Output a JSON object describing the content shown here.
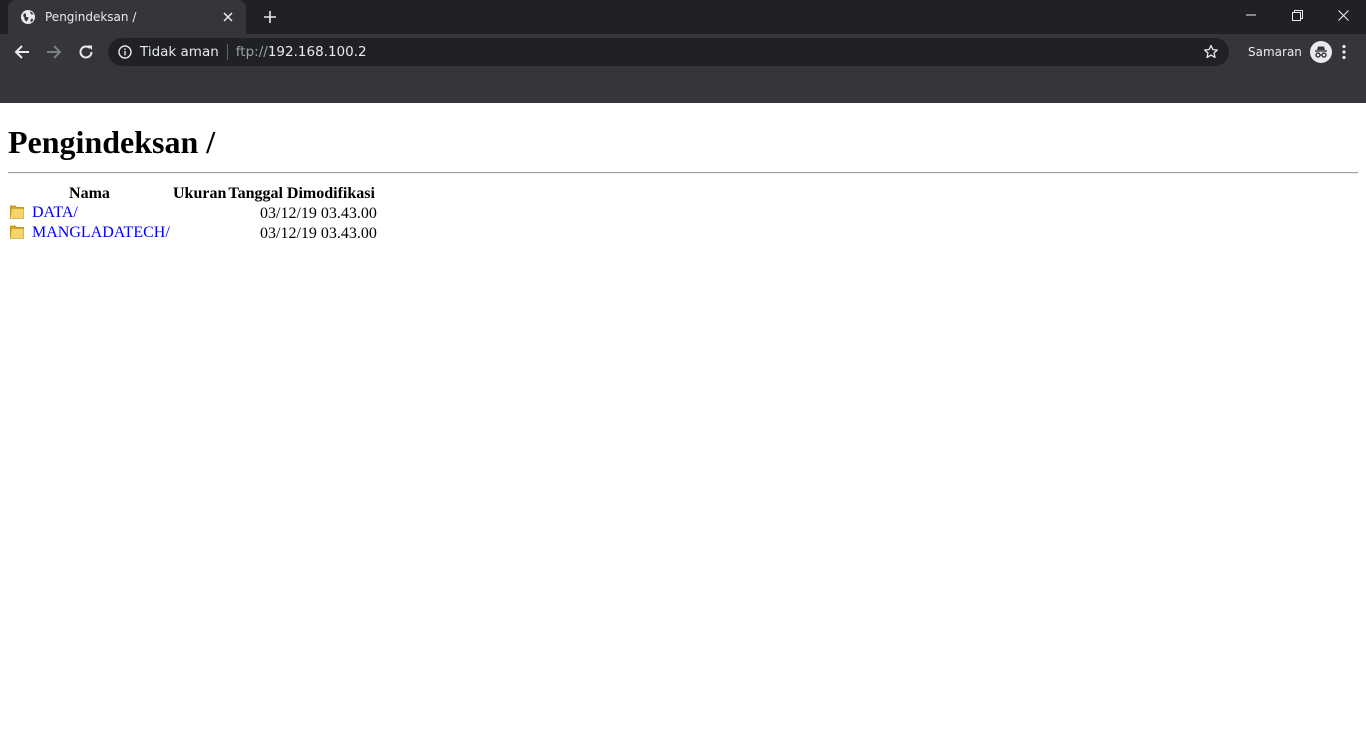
{
  "browser": {
    "tab": {
      "title": "Pengindeksan /",
      "favicon": "globe-icon"
    },
    "toolbar": {
      "security_label": "Tidak aman",
      "url_scheme": "ftp://",
      "url_host": "192.168.100.2",
      "profile_label": "Samaran"
    },
    "colors": {
      "tabstrip": "#202124",
      "toolbar": "#35363a",
      "omnibox": "#202124",
      "text": "#e8eaed",
      "muted": "#9aa0a6"
    }
  },
  "page": {
    "heading": "Pengindeksan /",
    "columns": {
      "name": "Nama",
      "size": "Ukuran",
      "modified": "Tanggal Dimodifikasi"
    },
    "rows": [
      {
        "name": "DATA/",
        "size": "",
        "modified": "03/12/19 03.43.00",
        "icon": "folder-icon"
      },
      {
        "name": "MANGLADATECH/",
        "size": "",
        "modified": "03/12/19 03.43.00",
        "icon": "folder-icon"
      }
    ],
    "link_color": "#0000ee"
  }
}
